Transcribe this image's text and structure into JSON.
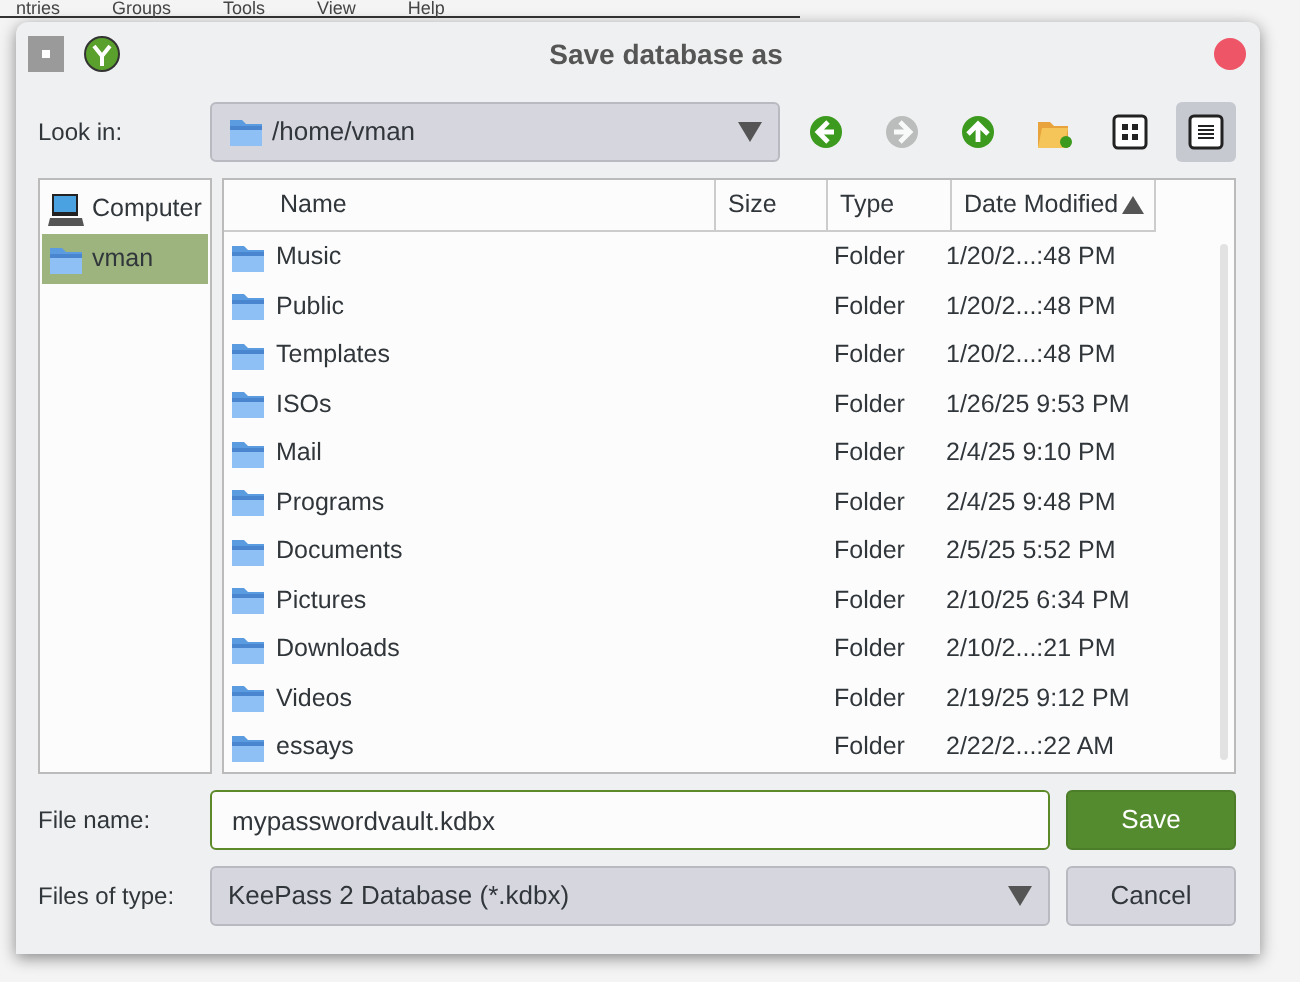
{
  "background_menu": [
    "ntries",
    "Groups",
    "Tools",
    "View",
    "Help"
  ],
  "window": {
    "title": "Save database as"
  },
  "look_in": {
    "label": "Look in:",
    "path": "/home/vman"
  },
  "toolbar": [
    {
      "kind": "back",
      "disabled": false
    },
    {
      "kind": "forward",
      "disabled": true
    },
    {
      "kind": "up",
      "disabled": false
    },
    {
      "kind": "new-folder",
      "disabled": false
    },
    {
      "kind": "icon-view",
      "selected": false
    },
    {
      "kind": "detail-view",
      "selected": true
    }
  ],
  "sidebar": {
    "items": [
      {
        "label": "Computer",
        "kind": "computer",
        "selected": false
      },
      {
        "label": "vman",
        "kind": "folder",
        "selected": true
      }
    ]
  },
  "table": {
    "columns": [
      {
        "label": "Name",
        "sorted": false
      },
      {
        "label": "Size",
        "sorted": false
      },
      {
        "label": "Type",
        "sorted": false
      },
      {
        "label": "Date Modified",
        "sorted": true
      }
    ],
    "rows": [
      {
        "name": "Music",
        "type": "Folder",
        "date": "1/20/2...:48 PM"
      },
      {
        "name": "Public",
        "type": "Folder",
        "date": "1/20/2...:48 PM"
      },
      {
        "name": "Templates",
        "type": "Folder",
        "date": "1/20/2...:48 PM"
      },
      {
        "name": "ISOs",
        "type": "Folder",
        "date": "1/26/25 9:53 PM"
      },
      {
        "name": "Mail",
        "type": "Folder",
        "date": "2/4/25 9:10 PM"
      },
      {
        "name": "Programs",
        "type": "Folder",
        "date": "2/4/25 9:48 PM"
      },
      {
        "name": "Documents",
        "type": "Folder",
        "date": "2/5/25 5:52 PM"
      },
      {
        "name": "Pictures",
        "type": "Folder",
        "date": "2/10/25 6:34 PM"
      },
      {
        "name": "Downloads",
        "type": "Folder",
        "date": "2/10/2...:21 PM"
      },
      {
        "name": "Videos",
        "type": "Folder",
        "date": "2/19/25 9:12 PM"
      },
      {
        "name": "essays",
        "type": "Folder",
        "date": "2/22/2...:22 AM"
      }
    ]
  },
  "file_name": {
    "label": "File name:",
    "value": "mypasswordvault.kdbx"
  },
  "file_type": {
    "label": "Files of type:",
    "value": "KeePass 2 Database (*.kdbx)"
  },
  "buttons": [
    {
      "label": "Save",
      "kind": "primary"
    },
    {
      "label": "Cancel",
      "kind": "secondary"
    }
  ]
}
